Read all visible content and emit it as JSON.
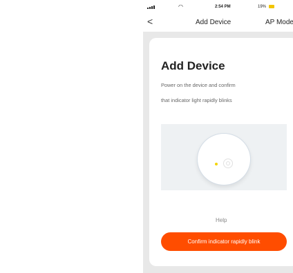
{
  "status_bar": {
    "time": "2:54 PM",
    "battery": "19%",
    "wifi_glyph": "◠"
  },
  "nav": {
    "back_glyph": "<",
    "title": "Add Device",
    "right_label": "AP Mode"
  },
  "card": {
    "title": "Add Device",
    "instruction_line1": "Power on the device and confirm",
    "instruction_line2": "that indicator light rapidly blinks",
    "help_label": "Help",
    "confirm_label": "Confirm indicator rapidly blink"
  },
  "colors": {
    "accent": "#ff4d00",
    "indicator_led": "#f4d400",
    "battery": "#f2c500",
    "background": "#e8e8e8"
  },
  "icons": {
    "signal": "signal-icon",
    "wifi": "wifi-icon",
    "battery": "battery-icon",
    "back": "back-arrow-icon",
    "power": "power-button-icon",
    "led": "indicator-light-icon"
  }
}
